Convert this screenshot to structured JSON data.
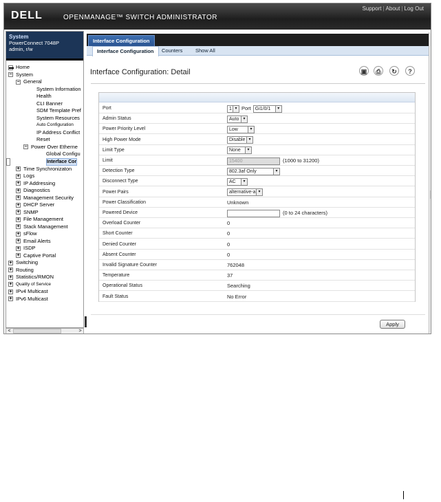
{
  "header": {
    "logo": "DELL",
    "app_title": "OPENMANAGE™ SWITCH ADMINISTRATOR",
    "links": [
      "Support",
      "About",
      "Log Out"
    ]
  },
  "sysinfo": {
    "title": "System",
    "model": "PowerConnect 7048P",
    "user": "admin, r/w"
  },
  "tree": [
    {
      "label": "Home",
      "indent": 0,
      "exp": "▬"
    },
    {
      "label": "System",
      "indent": 0,
      "exp": "−"
    },
    {
      "label": "General",
      "indent": 1,
      "exp": "−"
    },
    {
      "label": "System Information",
      "indent": 3,
      "exp": ""
    },
    {
      "label": "Health",
      "indent": 3,
      "exp": ""
    },
    {
      "label": "CLI Banner",
      "indent": 3,
      "exp": ""
    },
    {
      "label": "SDM Template Pref",
      "indent": 3,
      "exp": ""
    },
    {
      "label": "System Resources",
      "indent": 3,
      "exp": ""
    },
    {
      "label": "Auto Configuration",
      "indent": 3,
      "exp": "",
      "small": true
    },
    {
      "label": "IP Address Conflict",
      "indent": 3,
      "exp": ""
    },
    {
      "label": "Reset",
      "indent": 3,
      "exp": ""
    },
    {
      "label": "Power Over Etherne",
      "indent": 2,
      "exp": "−"
    },
    {
      "label": "Global Configu",
      "indent": 4,
      "exp": ""
    },
    {
      "label": "Interface Cor",
      "indent": 4,
      "exp": "",
      "selected": true
    },
    {
      "label": "Time Synchronizaton",
      "indent": 1,
      "exp": "+"
    },
    {
      "label": "Logs",
      "indent": 1,
      "exp": "+"
    },
    {
      "label": "IP Addressing",
      "indent": 1,
      "exp": "+"
    },
    {
      "label": "Diagnostics",
      "indent": 1,
      "exp": "+"
    },
    {
      "label": "Management Security",
      "indent": 1,
      "exp": "+"
    },
    {
      "label": "DHCP Server",
      "indent": 1,
      "exp": "+"
    },
    {
      "label": "SNMP",
      "indent": 1,
      "exp": "+"
    },
    {
      "label": "File Management",
      "indent": 1,
      "exp": "+"
    },
    {
      "label": "Stack Management",
      "indent": 1,
      "exp": "+"
    },
    {
      "label": "sFlow",
      "indent": 1,
      "exp": "+"
    },
    {
      "label": "Email Alerts",
      "indent": 1,
      "exp": "+"
    },
    {
      "label": "ISDP",
      "indent": 1,
      "exp": "+"
    },
    {
      "label": "Captive Portal",
      "indent": 1,
      "exp": "+"
    },
    {
      "label": "Switching",
      "indent": 0,
      "exp": "+"
    },
    {
      "label": "Routing",
      "indent": 0,
      "exp": "+"
    },
    {
      "label": "Statistics/RMON",
      "indent": 0,
      "exp": "+"
    },
    {
      "label": "Quality of Service",
      "indent": 0,
      "exp": "+",
      "small": true
    },
    {
      "label": "IPv4 Multicast",
      "indent": 0,
      "exp": "+"
    },
    {
      "label": "IPv6 Multicast",
      "indent": 0,
      "exp": "+"
    }
  ],
  "tabs": {
    "main": "Interface Configuration",
    "sub": [
      "Interface Configuration",
      "Counters",
      "Show All"
    ]
  },
  "page_title": "Interface Configuration: Detail",
  "toolbar_icons": [
    "save-icon",
    "print-icon",
    "refresh-icon",
    "help-icon"
  ],
  "form": {
    "rows": [
      {
        "label": "Port",
        "type": "port",
        "unit": "1",
        "port_label": "Port",
        "port": "Gi1/0/1"
      },
      {
        "label": "Admin Status",
        "type": "select",
        "value": "Auto"
      },
      {
        "label": "Power Priority Level",
        "type": "select",
        "value": "Low"
      },
      {
        "label": "High Power Mode",
        "type": "select",
        "value": "Disable"
      },
      {
        "label": "Limit Type",
        "type": "select",
        "value": "None"
      },
      {
        "label": "Limit",
        "type": "input_disabled",
        "value": "15400",
        "hint": "(1000 to 31200)"
      },
      {
        "label": "Detection Type",
        "type": "select",
        "value": "802.3af Only"
      },
      {
        "label": "Disconnect Type",
        "type": "select",
        "value": "AC"
      },
      {
        "label": "Power Pairs",
        "type": "select",
        "value": "alternative-a"
      },
      {
        "label": "Power Classification",
        "type": "text",
        "value": "Unknown"
      },
      {
        "label": "Powered Device",
        "type": "input",
        "value": "",
        "hint": "(0 to 24 characters)"
      },
      {
        "label": "Overload Counter",
        "type": "text",
        "value": "0"
      },
      {
        "label": "Short Counter",
        "type": "text",
        "value": "0"
      },
      {
        "label": "Denied Counter",
        "type": "text",
        "value": "0"
      },
      {
        "label": "Absent Counter",
        "type": "text",
        "value": "0"
      },
      {
        "label": "Invalid Signature Counter",
        "type": "text",
        "value": "762048"
      },
      {
        "label": "Temperature",
        "type": "text",
        "value": "37"
      },
      {
        "label": "Operational Status",
        "type": "text",
        "value": "Searching"
      },
      {
        "label": "Fault Status",
        "type": "text",
        "value": "No Error"
      }
    ],
    "apply_label": "Apply"
  }
}
